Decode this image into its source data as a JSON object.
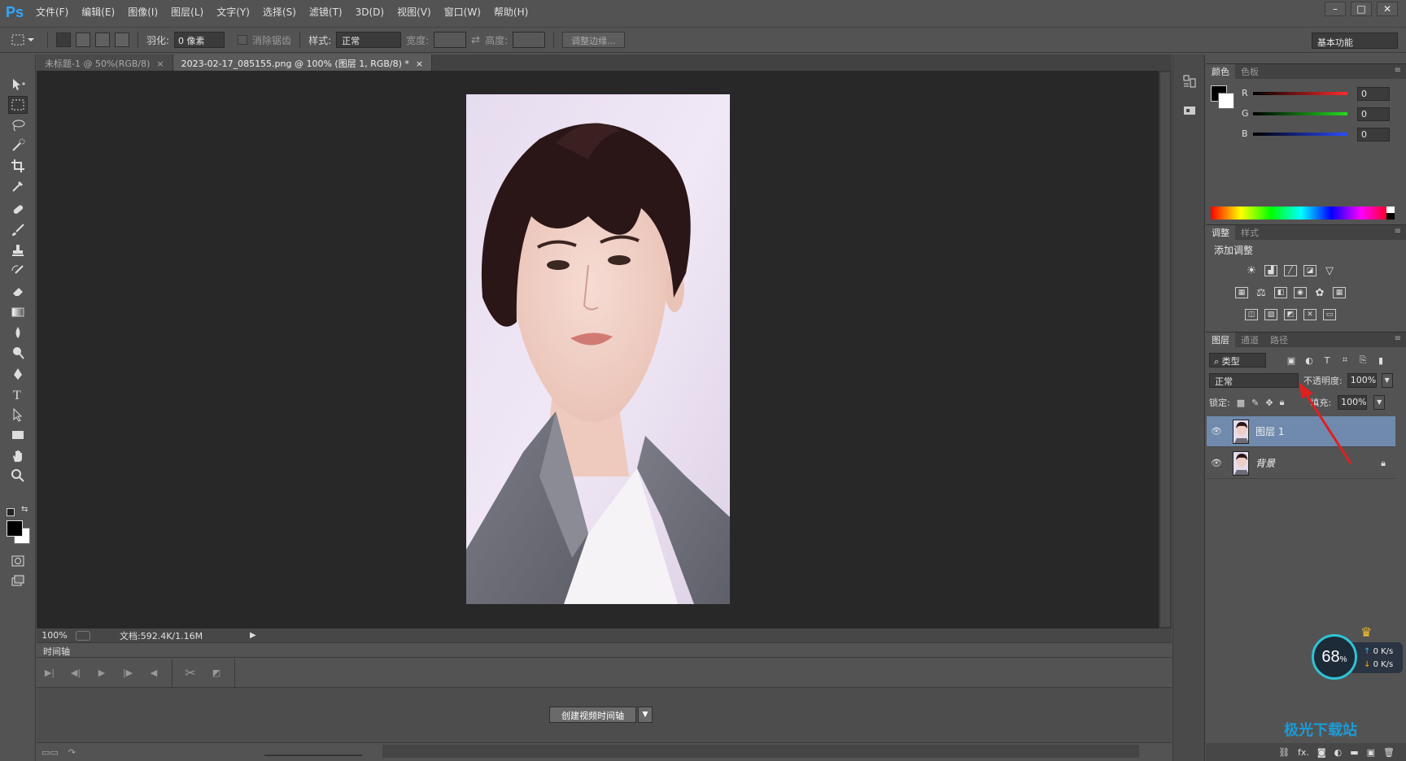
{
  "app": {
    "logo": "Ps"
  },
  "menu": [
    "文件(F)",
    "编辑(E)",
    "图像(I)",
    "图层(L)",
    "文字(Y)",
    "选择(S)",
    "滤镜(T)",
    "3D(D)",
    "视图(V)",
    "窗口(W)",
    "帮助(H)"
  ],
  "window_controls": {
    "minimize": "–",
    "maximize": "□",
    "close": "✕"
  },
  "options": {
    "feather_label": "羽化:",
    "feather_value": "0 像素",
    "antialias_label": "消除锯齿",
    "style_label": "样式:",
    "style_value": "正常",
    "width_label": "宽度:",
    "height_label": "高度:",
    "refine_edge": "调整边缘...",
    "workspace": "基本功能"
  },
  "doc_tabs": [
    {
      "title": "未标题-1 @ 50%(RGB/8)",
      "close": "×"
    },
    {
      "title": "2023-02-17_085155.png @ 100% (图层 1, RGB/8) *",
      "close": "×"
    }
  ],
  "status": {
    "zoom": "100%",
    "doc": "文档:592.4K/1.16M"
  },
  "timeline": {
    "title": "时间轴",
    "create_button": "创建视频时间轴"
  },
  "color_panel": {
    "tabs": [
      "颜色",
      "色板"
    ],
    "channels": [
      {
        "name": "R",
        "value": "0",
        "color": "#ff2a2a"
      },
      {
        "name": "G",
        "value": "0",
        "color": "#22dd22"
      },
      {
        "name": "B",
        "value": "0",
        "color": "#2a4cff"
      }
    ]
  },
  "adjust_panel": {
    "tabs": [
      "调整",
      "样式"
    ],
    "title": "添加调整"
  },
  "layers_panel": {
    "tabs": [
      "图层",
      "通道",
      "路径"
    ],
    "filter": "类型",
    "blend": "正常",
    "opacity_label": "不透明度:",
    "opacity": "100%",
    "lock_label": "锁定:",
    "fill_label": "填充:",
    "fill": "100%",
    "layers": [
      {
        "name": "图层 1",
        "selected": true
      },
      {
        "name": "背景",
        "selected": false
      }
    ],
    "footer_fx": "fx."
  },
  "net_widget": {
    "percent": "68",
    "unit": "%",
    "up": "0 K/s",
    "down": "0 K/s"
  },
  "watermark": "极光下载站"
}
